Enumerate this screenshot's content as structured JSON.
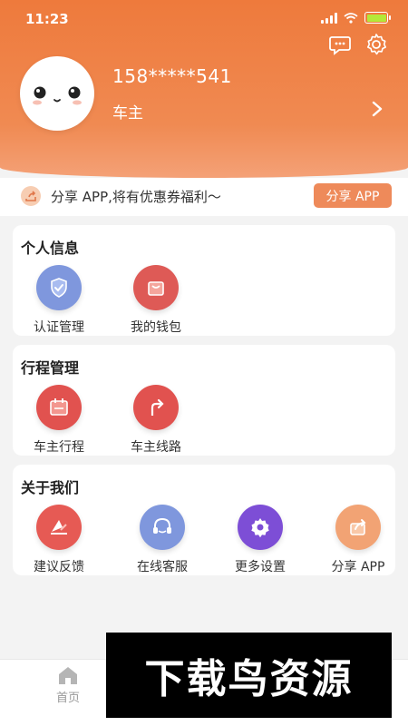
{
  "status": {
    "time": "11:23"
  },
  "profile": {
    "phone": "158*****541",
    "role": "车主"
  },
  "share_bar": {
    "text": "分享 APP,将有优惠券福利～",
    "button": "分享 APP"
  },
  "sections": [
    {
      "title": "个人信息",
      "items": [
        {
          "label": "认证管理",
          "icon": "shield-check-icon",
          "color": "#7f97dd"
        },
        {
          "label": "我的钱包",
          "icon": "wallet-bag-icon",
          "color": "#de5a56"
        }
      ]
    },
    {
      "title": "行程管理",
      "items": [
        {
          "label": "车主行程",
          "icon": "calendar-icon",
          "color": "#e1524f"
        },
        {
          "label": "车主线路",
          "icon": "route-arrow-icon",
          "color": "#e1524f"
        }
      ]
    },
    {
      "title": "关于我们",
      "items": [
        {
          "label": "建议反馈",
          "icon": "feedback-icon",
          "color": "#e65a54"
        },
        {
          "label": "在线客服",
          "icon": "headset-icon",
          "color": "#7f97dd"
        },
        {
          "label": "更多设置",
          "icon": "gear-icon",
          "color": "#7d4ed6"
        },
        {
          "label": "分享 APP",
          "icon": "share-icon",
          "color": "#f2a374"
        }
      ]
    }
  ],
  "tabbar": {
    "home": "首页"
  },
  "watermark": "下载鸟资源",
  "colors": {
    "header": "#ee7a3c",
    "accent": "#ee8a5a",
    "page_bg": "#f3f3f3"
  }
}
